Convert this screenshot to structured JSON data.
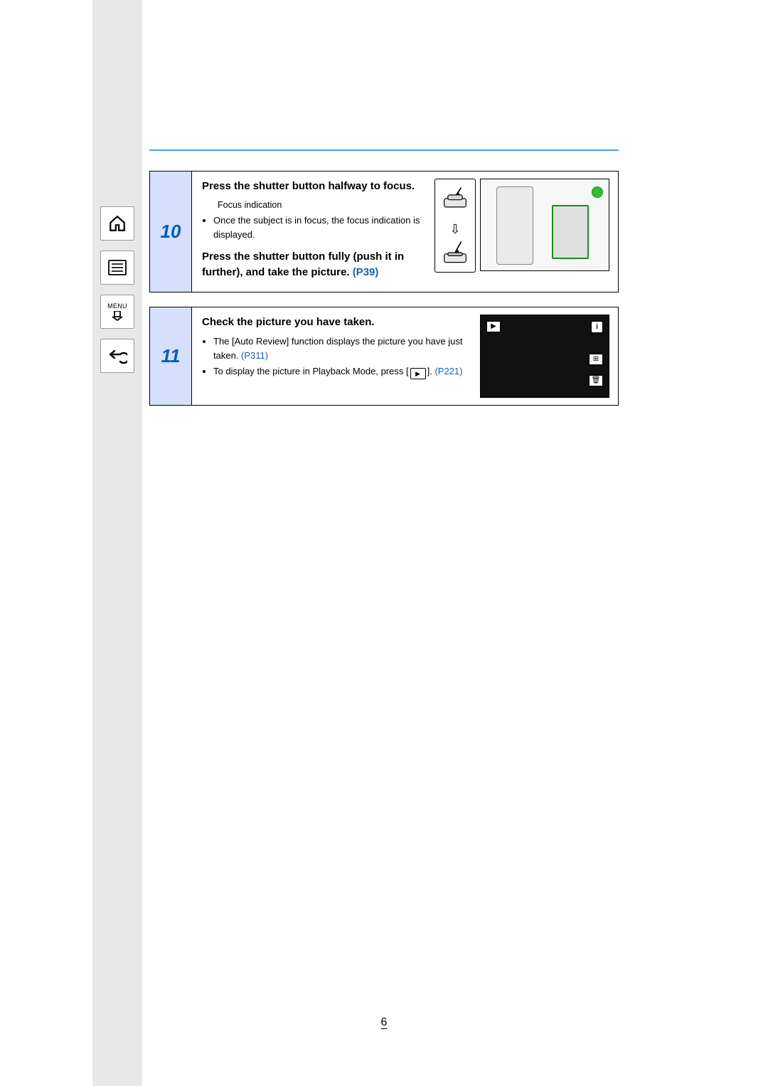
{
  "sidebar": {
    "menu_label": "MENU"
  },
  "steps": {
    "s10": {
      "num": "10",
      "h1": "Press the shutter button halfway to focus.",
      "legend": "Focus indication",
      "bullet1": "Once the subject is in focus, the focus indication is displayed.",
      "h2_prefix": "Press the shutter button fully (push it in further), and take the picture. ",
      "h2_link": "(P39)"
    },
    "s11": {
      "num": "11",
      "h1": "Check the picture you have taken.",
      "bullet1_prefix": "The [Auto Review] function displays the picture you have just taken. ",
      "bullet1_link": "(P311)",
      "bullet2_prefix": "To display the picture in Playback Mode, press [",
      "bullet2_suffix": "].",
      "bullet2_link": "(P221)"
    }
  },
  "page_number": "6",
  "icons": {
    "play_triangle": "▶",
    "down_arrow": "⇩",
    "info": "i",
    "grid": "⊞",
    "trash": "🗑"
  }
}
